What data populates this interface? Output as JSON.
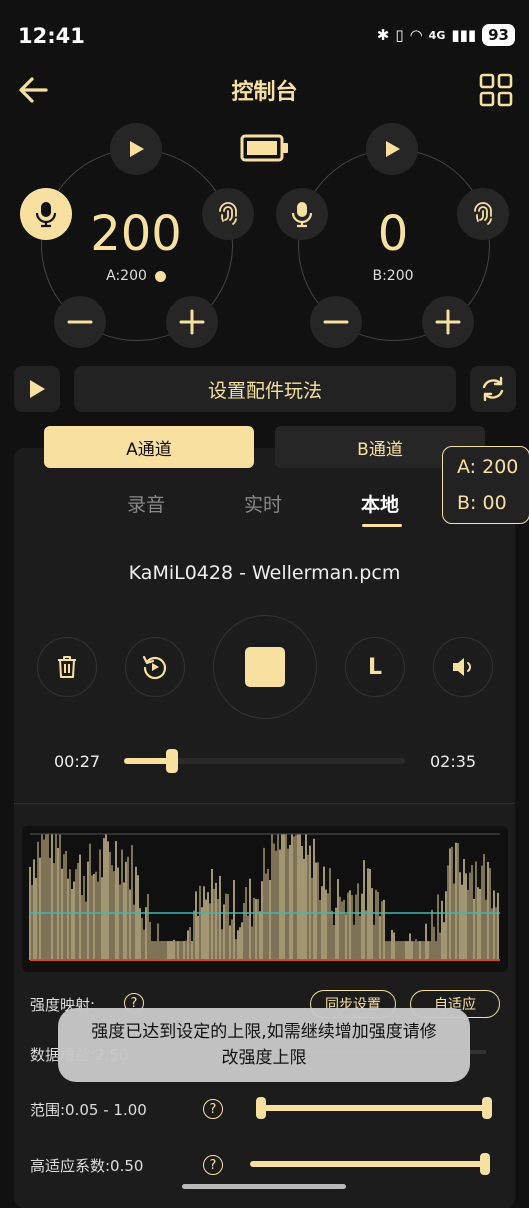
{
  "status": {
    "time": "12:41",
    "battery": "93",
    "network": "4G"
  },
  "header": {
    "title": "控制台"
  },
  "channel_a_dial": {
    "value": "200",
    "sub_label": "A:200"
  },
  "channel_b_dial": {
    "value": "0",
    "sub_label": "B:200"
  },
  "accessory": {
    "label": "设置配件玩法"
  },
  "channels": {
    "a_label": "A通道",
    "b_label": "B通道",
    "selected": "A"
  },
  "floating_status": {
    "line_a": "A: 200",
    "line_b": "B: 00"
  },
  "tabs": [
    {
      "label": "录音",
      "active": false
    },
    {
      "label": "实时",
      "active": false
    },
    {
      "label": "本地",
      "active": true
    }
  ],
  "player": {
    "file_name": "KaMiL0428 - Wellerman.pcm",
    "current_time": "00:27",
    "total_time": "02:35",
    "progress": 0.17,
    "loop_mode_label": "L"
  },
  "settings": {
    "intensity_mapping_label": "强度映射:",
    "sync_settings_label": "同步设置",
    "adaptive_label": "自适应",
    "data_gain_label": "数据增益:2.50",
    "range_label": "范围:0.05 - 1.00",
    "range_low": 0.05,
    "range_high": 1.0,
    "adaptive_coeff_label": "高适应系数:0.50"
  },
  "toast": {
    "message": "强度已达到设定的上限,如需继续增加强度请修改强度上限"
  },
  "colors": {
    "accent": "#f8e0a0",
    "background": "#111111",
    "panel": "#1c1c1c",
    "waveform_line": "#3fb8b0",
    "waveform_floor": "#d04a32"
  }
}
